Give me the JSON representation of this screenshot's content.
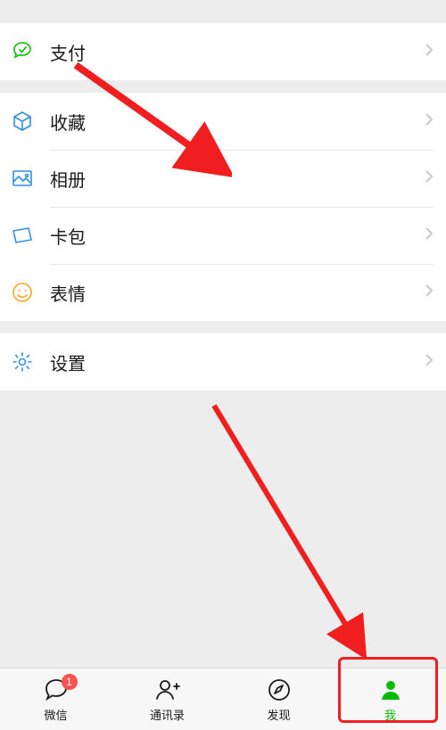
{
  "colors": {
    "accent": "#09bb07",
    "annotation": "#f01e1e",
    "badge": "#fa5151"
  },
  "rows": {
    "pay": {
      "label": "支付",
      "icon": "pay-icon"
    },
    "favorite": {
      "label": "收藏",
      "icon": "cube-icon"
    },
    "album": {
      "label": "相册",
      "icon": "photo-icon"
    },
    "cards": {
      "label": "卡包",
      "icon": "card-icon"
    },
    "sticker": {
      "label": "表情",
      "icon": "smile-icon"
    },
    "settings": {
      "label": "设置",
      "icon": "gear-icon"
    }
  },
  "tabs": {
    "chats": {
      "label": "微信",
      "badge": "1"
    },
    "contacts": {
      "label": "通讯录"
    },
    "discover": {
      "label": "发现"
    },
    "me": {
      "label": "我",
      "active": true
    }
  }
}
